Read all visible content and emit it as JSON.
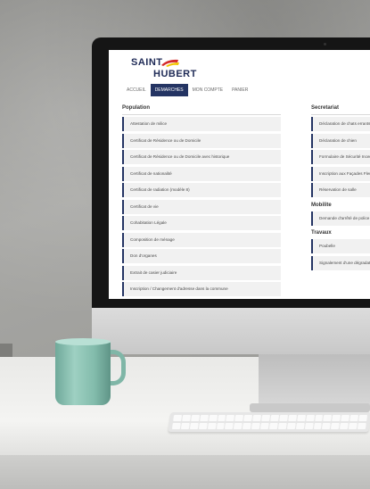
{
  "site": {
    "logo_line1": "SAINT",
    "logo_line2": "HUBERT"
  },
  "nav": {
    "items": [
      {
        "label": "ACCUEIL",
        "active": false
      },
      {
        "label": "DEMARCHES",
        "active": true
      },
      {
        "label": "MON COMPTE",
        "active": false
      },
      {
        "label": "PANIER",
        "active": false
      }
    ]
  },
  "population": {
    "title": "Population",
    "items": [
      "Attestation de milice",
      "Certificat de Résidence ou de Domicile",
      "Certificat de Résidence ou de Domicile avec historique",
      "Certificat de nationalité",
      "Certificat de radiation (modèle 8)",
      "Certificat de vie",
      "Cohabitation Légale",
      "Composition de ménage",
      "Don d'organes",
      "Extrait de casier judiciaire",
      "Inscription / Changement d'adresse dans la commune"
    ]
  },
  "secretariat": {
    "title": "Secretariat",
    "items": [
      "Déclaration de chats errants",
      "Déclaration de chien",
      "Formulaire de Sécurité Incendie",
      "Inscription aux Façades Fleuries",
      "Réservation de salle"
    ]
  },
  "mobilite": {
    "title": "Mobilite",
    "items": [
      "Demande d'arrêté de police"
    ]
  },
  "travaux": {
    "title": "Travaux",
    "items": [
      "Poubelle",
      "Signalement d'une dégradation"
    ]
  },
  "colors": {
    "brand_navy": "#243463",
    "logo_red": "#d42a2a",
    "logo_yellow": "#f2c500",
    "mug": "#8fc3b5"
  }
}
